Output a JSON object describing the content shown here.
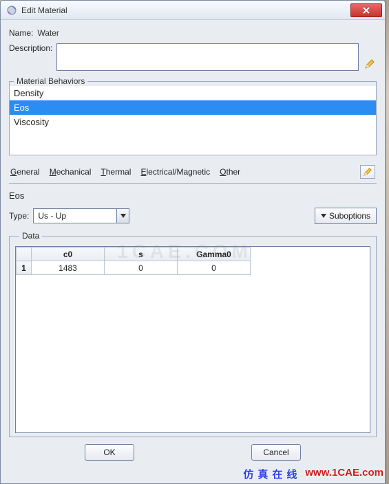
{
  "window": {
    "title": "Edit Material"
  },
  "fields": {
    "name_label": "Name:",
    "name_value": "Water",
    "desc_label": "Description:"
  },
  "behaviors": {
    "legend": "Material Behaviors",
    "items": [
      "Density",
      "Eos",
      "Viscosity"
    ],
    "selected": "Eos"
  },
  "menus": {
    "general": "General",
    "mechanical": "Mechanical",
    "thermal": "Thermal",
    "electrical": "Electrical/Magnetic",
    "other": "Other"
  },
  "eos": {
    "section_title": "Eos",
    "type_label": "Type:",
    "type_value": "Us - Up",
    "suboptions_label": "Suboptions",
    "data_legend": "Data",
    "table": {
      "headers": {
        "c0": "c0",
        "s": "s",
        "gamma0": "Gamma0"
      },
      "rows": [
        {
          "idx": "1",
          "c0": "1483",
          "s": "0",
          "gamma0": "0"
        }
      ]
    }
  },
  "buttons": {
    "ok": "OK",
    "cancel": "Cancel"
  },
  "watermark": "1CAE.COM",
  "footer": {
    "cn": "仿真在线",
    "url": "www.1CAE.com"
  }
}
